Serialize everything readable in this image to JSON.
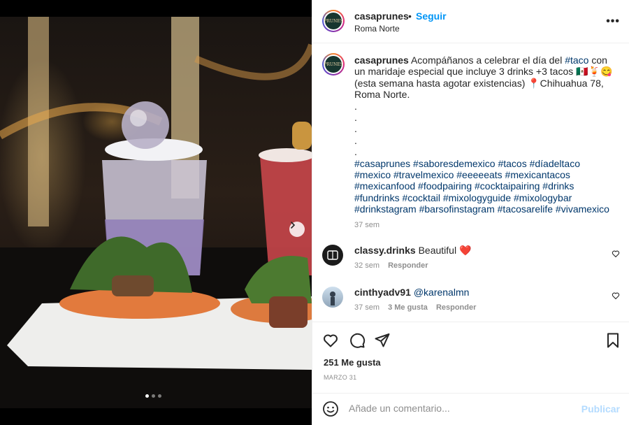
{
  "post": {
    "username": "casaprunes",
    "separator": "•",
    "follow_label": "Seguir",
    "location": "Roma Norte",
    "avatar_text": "PRUNES",
    "more_label": "•••"
  },
  "caption": {
    "username": "casaprunes",
    "text_1": " Acompáñanos a celebrar el día del ",
    "tag_taco": "#taco",
    "text_2": " con un maridaje especial que incluye 3 drinks +3 tacos 🇲🇽🍹😋 (esta semana hasta agotar existencias) 📍Chihuahua 78, Roma Norte.",
    "dots": [
      ".",
      ".",
      ".",
      ".",
      "."
    ],
    "hashtags": "#casaprunes #saboresdemexico #tacos #díadeltaco #mexico #travelmexico #eeeeeats #mexicantacos #mexicanfood #foodpairing #cocktaipairing #drinks #fundrinks #cocktail #mixologyguide #mixologybar #drinkstagram #barsofinstagram #tacosarelife #vivamexico",
    "time": "37 sem"
  },
  "comments": [
    {
      "username": "classy.drinks",
      "text": " Beautiful ❤️",
      "time": "32 sem",
      "reply_label": "Responder"
    },
    {
      "username": "cinthyadv91",
      "text": " @karenalmn",
      "time": "37 sem",
      "likes_label": "3 Me gusta",
      "reply_label": "Responder"
    }
  ],
  "engagement": {
    "likes": "251 Me gusta",
    "date": "MARZO 31"
  },
  "add_comment": {
    "placeholder": "Añade un comentario...",
    "publish_label": "Publicar"
  },
  "carousel": {
    "slide_count": 3,
    "active_index": 0
  },
  "colors": {
    "accent": "#0095f6",
    "hashtag": "#00376b",
    "muted": "#8e8e8e",
    "publish_disabled": "#b3dbff"
  }
}
